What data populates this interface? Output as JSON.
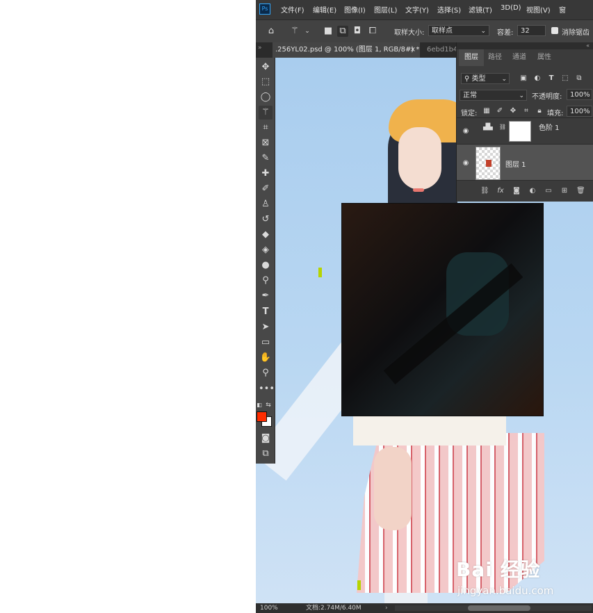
{
  "menu": {
    "items": [
      "文件(F)",
      "编辑(E)",
      "图像(I)",
      "图层(L)",
      "文字(Y)",
      "选择(S)",
      "滤镜(T)",
      "3D(D)",
      "视图(V)",
      "窗"
    ],
    "app_logo": "Ps"
  },
  "options": {
    "sample_size_label": "取样大小:",
    "sample_size_value": "取样点",
    "tolerance_label": "容差:",
    "tolerance_value": "32",
    "antialias_label": "消除锯齿"
  },
  "tabs": {
    "active": ".256YL02.psd @ 100% (图层 1, RGB/8#) *",
    "active_close": "×",
    "inactive": "6ebd1b4"
  },
  "layers_panel": {
    "tabs": [
      "图层",
      "路径",
      "通道",
      "属性"
    ],
    "filter_kind": "类型",
    "blend_mode": "正常",
    "opacity_label": "不透明度:",
    "opacity_value": "100%",
    "lock_label": "锁定:",
    "fill_label": "填充:",
    "fill_value": "100%",
    "layers": [
      {
        "name": "色阶 1",
        "type": "adjustment",
        "visible": true,
        "selected": false
      },
      {
        "name": "图层 1",
        "type": "pixel",
        "visible": true,
        "selected": true
      }
    ],
    "footer_icons": [
      "link-icon",
      "fx-icon",
      "mask-icon",
      "adjustment-icon",
      "folder-icon",
      "new-layer-icon",
      "trash-icon"
    ],
    "footer_fx": "fx"
  },
  "toolbar": {
    "tools": [
      "move",
      "marquee",
      "lasso",
      "magic-wand",
      "crop",
      "frame",
      "eyedropper",
      "healing",
      "brush",
      "stamp",
      "history-brush",
      "eraser",
      "paint-bucket",
      "blur",
      "dodge",
      "pen",
      "type",
      "path-select",
      "rectangle",
      "hand",
      "zoom",
      "more"
    ],
    "type_tool_label": "T",
    "foreground_color": "#ff2d00",
    "background_color": "#ffffff"
  },
  "status": {
    "zoom": "100%",
    "doc_info": "文档:2.74M/6.40M"
  },
  "watermark": {
    "logo_text": "Bai 经验",
    "url": "jingyan.baidu.com"
  }
}
